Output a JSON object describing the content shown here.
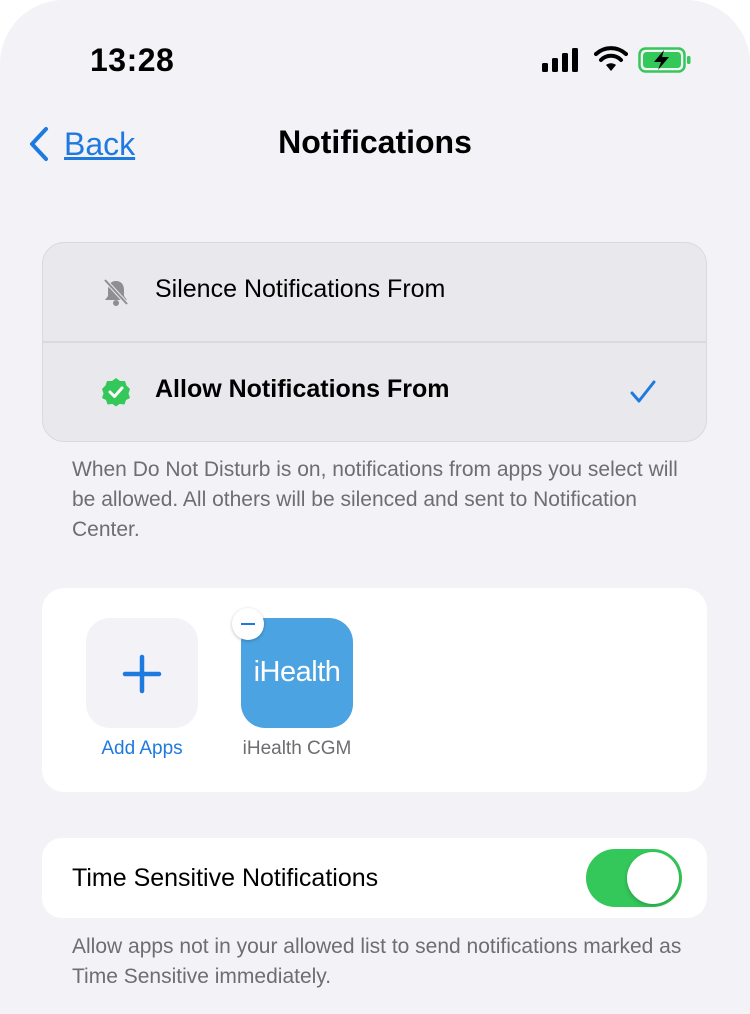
{
  "status_bar": {
    "time": "13:28",
    "icons": [
      "cellular-signal-icon",
      "wifi-icon",
      "battery-charging-icon"
    ]
  },
  "nav": {
    "back_label": "Back",
    "title": "Notifications"
  },
  "options": [
    {
      "label": "Silence Notifications From",
      "icon": "bell-slash-icon",
      "selected": false
    },
    {
      "label": "Allow Notifications From",
      "icon": "checkmark-seal-icon",
      "selected": true
    }
  ],
  "allow_footer": "When Do Not Disturb is on, notifications from apps you select will be allowed. All others will be silenced and sent to Notification Center.",
  "apps": {
    "add_label": "Add Apps",
    "items": [
      {
        "logo_text": "iHealth",
        "name": "iHealth CGM"
      }
    ]
  },
  "time_sensitive": {
    "label": "Time Sensitive Notifications",
    "enabled": true,
    "footer": "Allow apps not in your allowed list to send notifications marked as Time Sensitive immediately."
  },
  "colors": {
    "accent": "#1f7ae0",
    "toggle_on": "#34c759",
    "background": "#f2f2f7",
    "app_icon": "#4ba3e2"
  }
}
